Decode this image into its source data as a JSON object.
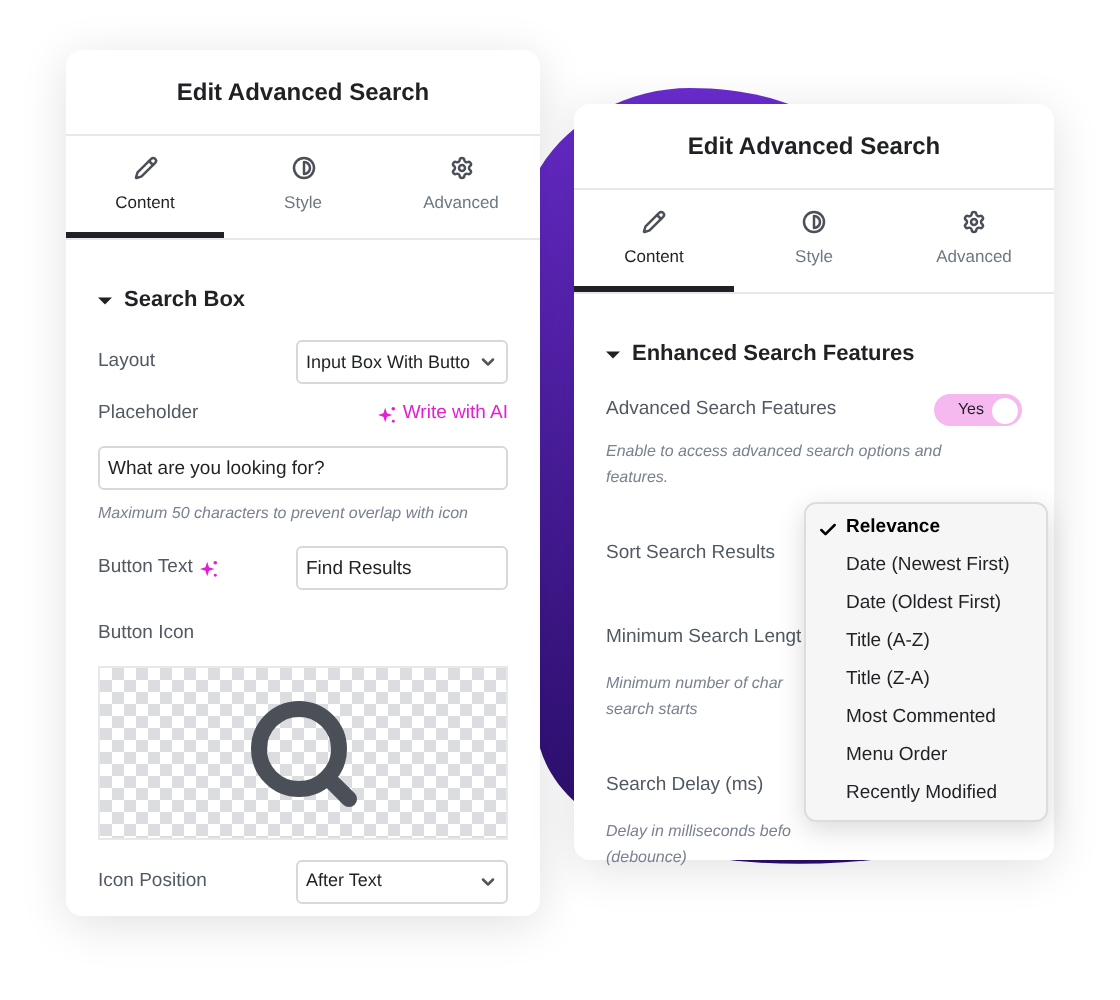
{
  "left_panel": {
    "title": "Edit Advanced Search",
    "tabs": [
      {
        "label": "Content",
        "selected": true
      },
      {
        "label": "Style",
        "selected": false
      },
      {
        "label": "Advanced",
        "selected": false
      }
    ],
    "section": {
      "title": "Search Box",
      "expanded": true
    },
    "fields": [
      {
        "kind": "select",
        "label": "Layout",
        "value": "Input Box With Butto"
      },
      {
        "kind": "text",
        "label": "Placeholder",
        "ai_link": "Write with AI",
        "value": "What are you looking for?",
        "help": "Maximum 50 characters to prevent overlap with icon"
      },
      {
        "kind": "inline_text",
        "label": "Button Text",
        "ai_icon": true,
        "value": "Find Results"
      },
      {
        "kind": "icon_picker",
        "label": "Button Icon"
      },
      {
        "kind": "select",
        "label": "Icon Position",
        "value": "After Text"
      }
    ]
  },
  "right_panel": {
    "title": "Edit Advanced Search",
    "tabs": [
      {
        "label": "Content",
        "selected": true
      },
      {
        "label": "Style",
        "selected": false
      },
      {
        "label": "Advanced",
        "selected": false
      }
    ],
    "section": {
      "title": "Enhanced Search Features",
      "expanded": true
    },
    "fields": [
      {
        "kind": "switch",
        "label": "Advanced Search Features",
        "on": true,
        "switch_text": "Yes",
        "help": [
          "Enable to access advanced search options and",
          "features."
        ]
      },
      {
        "kind": "row",
        "label": "Sort Search Results"
      },
      {
        "kind": "row",
        "label": "Minimum Search Lengt",
        "help": [
          "Minimum number of char",
          "search starts"
        ]
      },
      {
        "kind": "row",
        "label": "Search Delay (ms)",
        "help": [
          "Delay in milliseconds befo",
          "(debounce)"
        ]
      }
    ]
  },
  "dropdown": {
    "items": [
      {
        "label": "Relevance",
        "selected": true
      },
      {
        "label": "Date (Newest First)",
        "selected": false
      },
      {
        "label": "Date (Oldest First)",
        "selected": false
      },
      {
        "label": "Title (A-Z)",
        "selected": false
      },
      {
        "label": "Title (Z-A)",
        "selected": false
      },
      {
        "label": "Most Commented",
        "selected": false
      },
      {
        "label": "Menu Order",
        "selected": false
      },
      {
        "label": "Recently Modified",
        "selected": false
      }
    ]
  }
}
